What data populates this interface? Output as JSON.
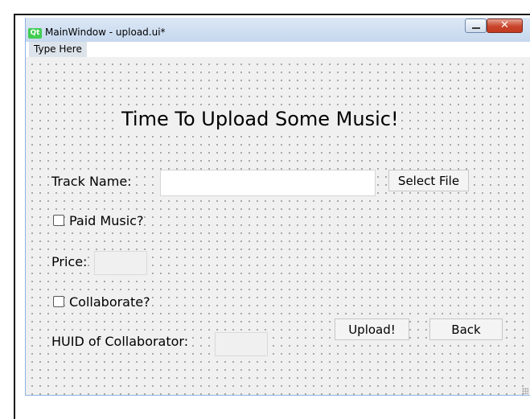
{
  "window": {
    "title": "MainWindow - upload.ui*",
    "logo_text": "Qt",
    "close_glyph": "✕"
  },
  "menu": {
    "items": [
      {
        "label": "Type Here"
      }
    ]
  },
  "form": {
    "heading": "Time To Upload Some Music!",
    "track_name_label": "Track Name:",
    "track_name_value": "",
    "select_file_label": "Select File",
    "paid_music_label": "Paid Music?",
    "paid_music_checked": false,
    "price_label": "Price:",
    "price_value": "",
    "collaborate_label": "Collaborate?",
    "collaborate_checked": false,
    "huid_label": "HUID of Collaborator:",
    "huid_value": "",
    "upload_label": "Upload!",
    "back_label": "Back"
  },
  "icons": {
    "logo": "qt-logo-icon",
    "minimize": "minimize-icon",
    "close": "close-icon",
    "grip": "resize-grip-icon"
  },
  "colors": {
    "window_background": "#f0f0f0",
    "titlebar": "#c6d8ee",
    "qt_brand": "#41cd52",
    "close_button": "#c8442b"
  }
}
